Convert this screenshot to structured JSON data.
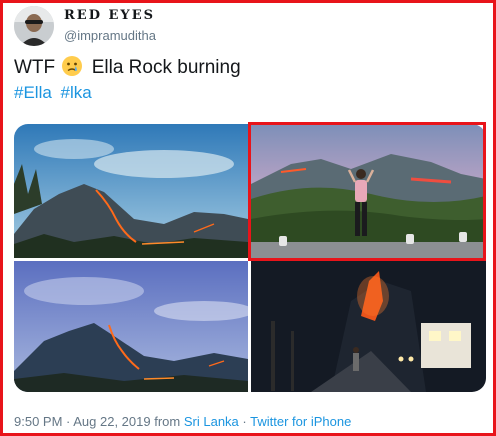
{
  "author": {
    "display_name": "RED EYES",
    "handle": "@impramuditha"
  },
  "tweet": {
    "text_before_emoji": "WTF",
    "emoji": "crying-face",
    "text_after_emoji": "Ella Rock burning",
    "hashtags": [
      "#Ella",
      "#lka"
    ]
  },
  "media": {
    "tiles": [
      {
        "icon": "mountain-fire-photo"
      },
      {
        "icon": "woman-watching-fire-photo"
      },
      {
        "icon": "mountain-fire-dusk-photo"
      },
      {
        "icon": "night-road-fire-photo"
      }
    ]
  },
  "footer": {
    "timestamp": "9:50 PM · Aug 22, 2019",
    "from_text": "from",
    "location": "Sri Lanka",
    "separator": "·",
    "source": "Twitter for iPhone"
  },
  "colors": {
    "link": "#1b95e0",
    "highlight_border": "#e8141a",
    "secondary_text": "#657786"
  }
}
